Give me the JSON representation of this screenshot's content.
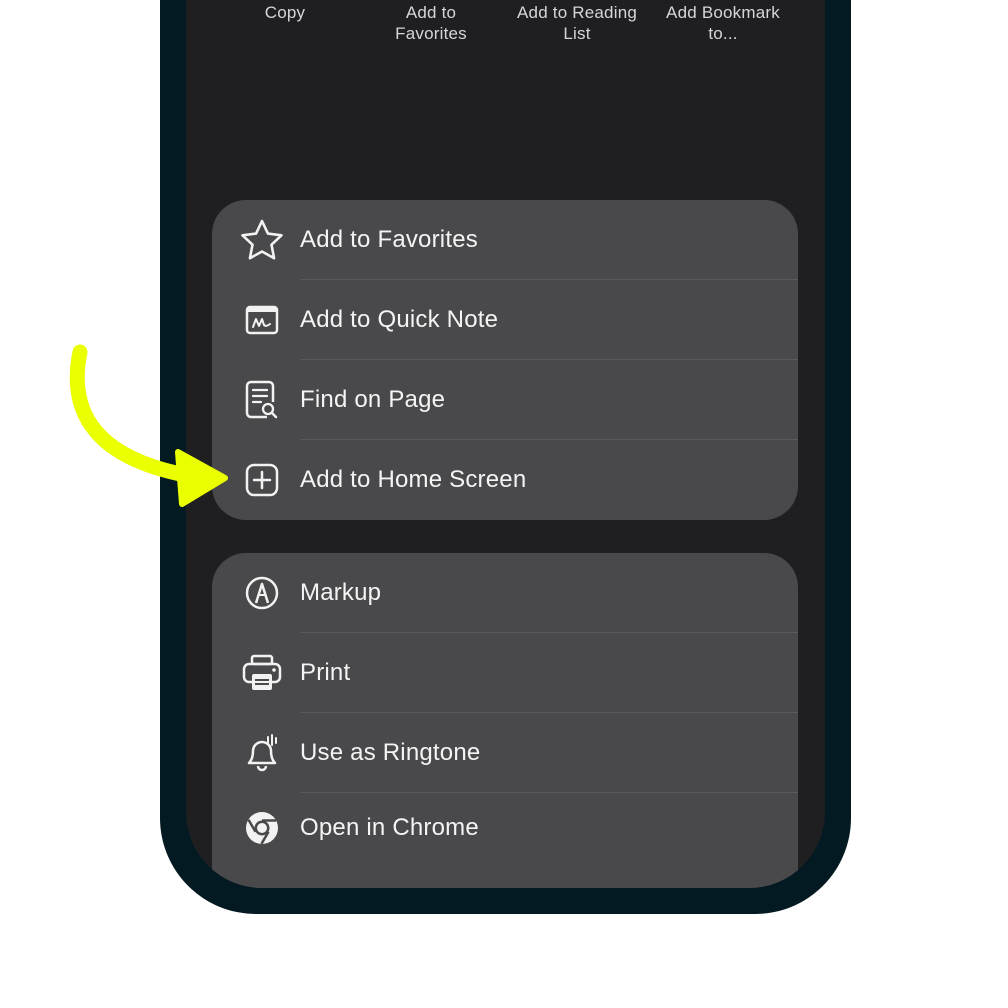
{
  "actions": [
    {
      "label": "Copy",
      "icon": "copy-icon"
    },
    {
      "label": "Add to\nFavorites",
      "icon": "bookmark-icon"
    },
    {
      "label": "Add to Reading\nList",
      "icon": "glasses-icon"
    },
    {
      "label": "Add Bookmark\nto...",
      "icon": "book-icon"
    }
  ],
  "menu_primary": [
    {
      "label": "Add to Favorites",
      "icon": "star-icon"
    },
    {
      "label": "Add to Quick Note",
      "icon": "quick-note-icon"
    },
    {
      "label": "Find on Page",
      "icon": "find-page-icon"
    },
    {
      "label": "Add to Home Screen",
      "icon": "add-square-icon"
    }
  ],
  "menu_secondary": [
    {
      "label": "Markup",
      "icon": "markup-icon"
    },
    {
      "label": "Print",
      "icon": "printer-icon"
    },
    {
      "label": "Use as Ringtone",
      "icon": "bell-icon"
    },
    {
      "label": "Open in Chrome",
      "icon": "chrome-icon"
    }
  ],
  "colors": {
    "frame": "#041a22",
    "screen": "#1f1f21",
    "action_circle": "#373739",
    "menu_group": "#49494b",
    "text": "#f4f4f5",
    "highlight_arrow": "#eaff00"
  }
}
